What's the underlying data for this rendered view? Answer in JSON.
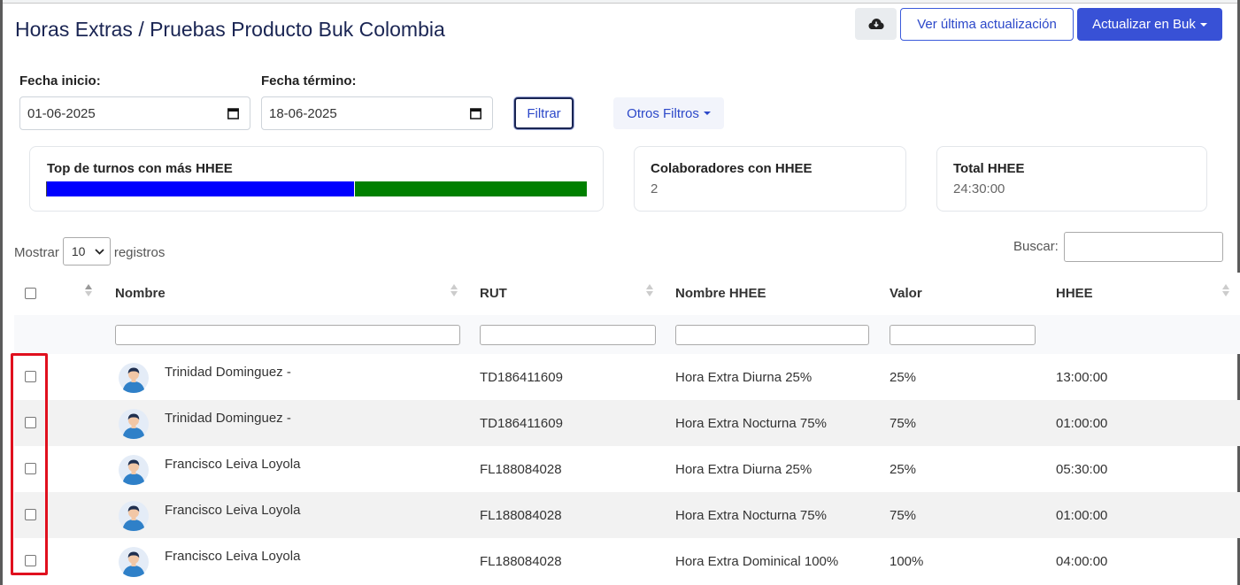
{
  "header": {
    "title": "Horas Extras / Pruebas Producto Buk Colombia",
    "ver_label": "Ver última actualización",
    "actualizar_label": "Actualizar en Buk",
    "cloud_icon": "cloud-download-icon"
  },
  "filters": {
    "start_label": "Fecha inicio:",
    "start_value": "01-06-2025",
    "end_label": "Fecha término:",
    "end_value": "18-06-2025",
    "filtrar_label": "Filtrar",
    "otros_label": "Otros Filtros"
  },
  "cards": {
    "top_turnos": {
      "title": "Top de turnos con más HHEE",
      "segments": [
        {
          "fraction": 0.57,
          "color": "#0000ff"
        },
        {
          "fraction": 0.43,
          "color": "#008000"
        }
      ]
    },
    "colaboradores": {
      "title": "Colaboradores con HHEE",
      "value": "2"
    },
    "total": {
      "title": "Total HHEE",
      "value": "24:30:00"
    }
  },
  "table_controls": {
    "mostrar_label": "Mostrar",
    "page_size": "10",
    "registros_label": "registros",
    "buscar_label": "Buscar:"
  },
  "table": {
    "headers": {
      "nombre": "Nombre",
      "rut": "RUT",
      "nombre_hhee": "Nombre HHEE",
      "valor": "Valor",
      "hhee": "HHEE"
    },
    "rows": [
      {
        "nombre": "Trinidad Dominguez -",
        "rut": "TD186411609",
        "nombre_hhee": "Hora Extra Diurna 25%",
        "valor": "25%",
        "hhee": "13:00:00"
      },
      {
        "nombre": "Trinidad Dominguez -",
        "rut": "TD186411609",
        "nombre_hhee": "Hora Extra Nocturna 75%",
        "valor": "75%",
        "hhee": "01:00:00"
      },
      {
        "nombre": "Francisco Leiva Loyola",
        "rut": "FL188084028",
        "nombre_hhee": "Hora Extra Diurna 25%",
        "valor": "25%",
        "hhee": "05:30:00"
      },
      {
        "nombre": "Francisco Leiva Loyola",
        "rut": "FL188084028",
        "nombre_hhee": "Hora Extra Nocturna 75%",
        "valor": "75%",
        "hhee": "01:00:00"
      },
      {
        "nombre": "Francisco Leiva Loyola",
        "rut": "FL188084028",
        "nombre_hhee": "Hora Extra Dominical 100%",
        "valor": "100%",
        "hhee": "04:00:00"
      }
    ]
  },
  "colors": {
    "primary": "#3851d6",
    "title": "#1a2553",
    "highlight": "#e0101e"
  }
}
